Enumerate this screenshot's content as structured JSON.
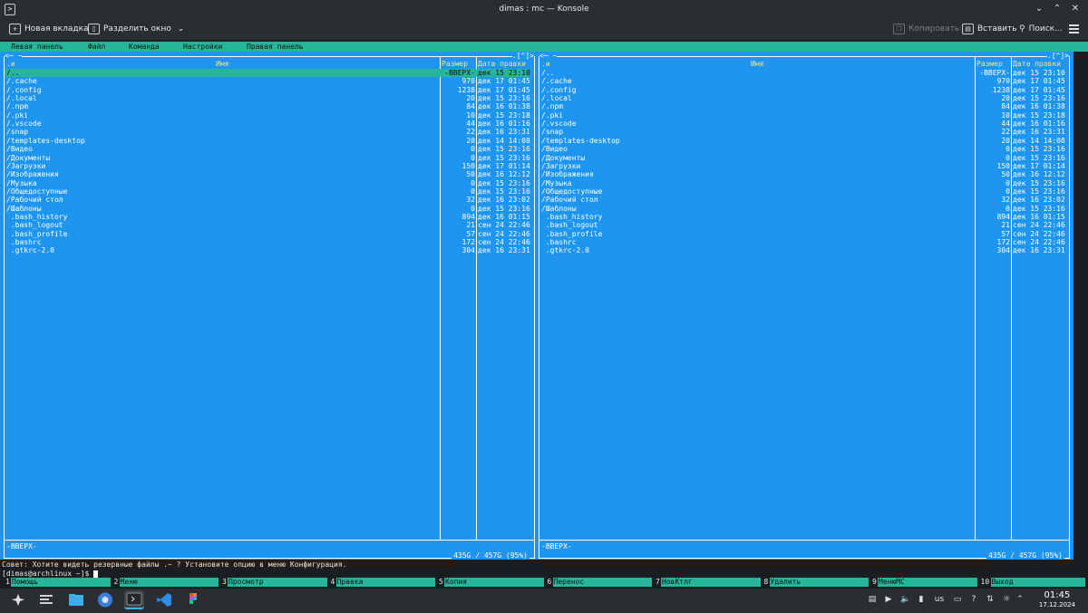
{
  "window": {
    "title": "dimas : mc — Konsole",
    "app_icon": "terminal-icon",
    "buttons": [
      "minimize-icon",
      "maximize-icon",
      "close-icon"
    ]
  },
  "toolbar": {
    "new_tab": "Новая вкладка",
    "split_view": "Разделить окно",
    "copy": "Копировать",
    "paste": "Вставить",
    "find": "Поиск..."
  },
  "mc": {
    "menubar": {
      "left_panel": "Левая панель",
      "file": "Файл",
      "command": "Команда",
      "options": "Настройки",
      "right_panel": "Правая панель"
    },
    "panels": [
      {
        "path_left": "<─ ~",
        "path_right": ".[^]>",
        "header": {
          "sort": ".и",
          "name": "Имя",
          "size": "Размер",
          "date": "Дата правки"
        },
        "footer": "-ВВЕРХ-",
        "disk": "435G / 457G (95%)",
        "selected_index": 0
      },
      {
        "path_left": "<─ ~",
        "path_right": ".[^]>",
        "header": {
          "sort": ".и",
          "name": "Имя",
          "size": "Размер",
          "date": "Дата правки"
        },
        "footer": "-ВВЕРХ-",
        "disk": "435G / 457G (95%)",
        "selected_index": -1
      }
    ],
    "files": [
      {
        "name": "/..",
        "size": "-ВВЕРХ-",
        "date": "дек 15 23:10"
      },
      {
        "name": "/.cache",
        "size": "970",
        "date": "дек 17 01:45"
      },
      {
        "name": "/.config",
        "size": "1238",
        "date": "дек 17 01:45"
      },
      {
        "name": "/.local",
        "size": "20",
        "date": "дек 15 23:16"
      },
      {
        "name": "/.npm",
        "size": "84",
        "date": "дек 16 01:38"
      },
      {
        "name": "/.pki",
        "size": "10",
        "date": "дек 15 23:18"
      },
      {
        "name": "/.vscode",
        "size": "44",
        "date": "дек 16 01:16"
      },
      {
        "name": "/snap",
        "size": "22",
        "date": "дек 16 23:31"
      },
      {
        "name": "/templates-desktop",
        "size": "20",
        "date": "дек 14 14:08"
      },
      {
        "name": "/Видео",
        "size": "0",
        "date": "дек 15 23:16"
      },
      {
        "name": "/Документы",
        "size": "0",
        "date": "дек 15 23:16"
      },
      {
        "name": "/Загрузки",
        "size": "150",
        "date": "дек 17 01:14"
      },
      {
        "name": "/Изображения",
        "size": "50",
        "date": "дек 16 12:12"
      },
      {
        "name": "/Музыка",
        "size": "0",
        "date": "дек 15 23:16"
      },
      {
        "name": "/Общедоступные",
        "size": "0",
        "date": "дек 15 23:16"
      },
      {
        "name": "/Рабочий стол",
        "size": "32",
        "date": "дек 16 23:02"
      },
      {
        "name": "/Шаблоны",
        "size": "0",
        "date": "дек 15 23:16"
      },
      {
        "name": " .bash_history",
        "size": "894",
        "date": "дек 16 01:15"
      },
      {
        "name": " .bash_logout",
        "size": "21",
        "date": "сен 24 22:46"
      },
      {
        "name": " .bash_profile",
        "size": "57",
        "date": "сен 24 22:46"
      },
      {
        "name": " .bashrc",
        "size": "172",
        "date": "сен 24 22:46"
      },
      {
        "name": " .gtkrc-2.0",
        "size": "304",
        "date": "дек 16 23:31"
      }
    ],
    "hint": "Совет: Хотите видеть резервные файлы .~ ? Установите опцию в меню Конфигурация.",
    "prompt": "[dimas@archlinux ~]$ ",
    "fkeys": [
      {
        "num": "1",
        "label": "Помощь"
      },
      {
        "num": "2",
        "label": "Меню"
      },
      {
        "num": "3",
        "label": "Просмотр"
      },
      {
        "num": "4",
        "label": "Правка"
      },
      {
        "num": "5",
        "label": "Копия"
      },
      {
        "num": "6",
        "label": "Перенос"
      },
      {
        "num": "7",
        "label": "НовКтлг"
      },
      {
        "num": "8",
        "label": "Удалить"
      },
      {
        "num": "9",
        "label": "МенюMC"
      },
      {
        "num": "10",
        "label": "Выход"
      }
    ]
  },
  "taskbar": {
    "apps": [
      "app-launcher-icon",
      "task-manager-icon",
      "file-manager-icon",
      "chrome-icon",
      "konsole-icon",
      "vscode-icon",
      "figma-icon"
    ],
    "keyboard_layout": "us",
    "time": "01:45",
    "date": "17.12.2024"
  },
  "colors": {
    "panel_bg": "#1e95ee",
    "selection": "#27b69a",
    "header_text": "#f4e77a",
    "terminal_bg": "#1b1e20"
  }
}
